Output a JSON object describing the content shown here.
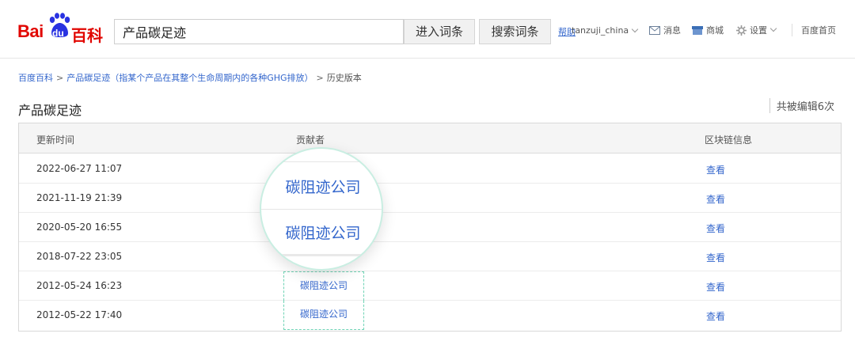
{
  "header": {
    "logo_text": "Bai",
    "logo_du": "du",
    "logo_baike": "百科",
    "search_value": "产品碳足迹",
    "enter_button": "进入词条",
    "search_button": "搜索词条",
    "help": "帮助",
    "username": "tanzuji_china",
    "messages": "消息",
    "mall": "商城",
    "settings": "设置",
    "home": "百度首页"
  },
  "breadcrumb": {
    "root": "百度百科",
    "entry": "产品碳足迹（指某个产品在其整个生命周期内的各种GHG排放）",
    "current": "历史版本",
    "separator": ">"
  },
  "page": {
    "title": "产品碳足迹",
    "edit_count": "共被编辑6次"
  },
  "table": {
    "columns": [
      "更新时间",
      "贡献者",
      "区块链信息"
    ],
    "rows": [
      {
        "time": "2022-06-27 11:07",
        "contributor": "",
        "chain": "查看"
      },
      {
        "time": "2021-11-19 21:39",
        "contributor": "",
        "chain": "查看"
      },
      {
        "time": "2020-05-20 16:55",
        "contributor": "",
        "chain": "查看"
      },
      {
        "time": "2018-07-22 23:05",
        "contributor": "",
        "chain": "查看"
      },
      {
        "time": "2012-05-24 16:23",
        "contributor": "碳阻迹公司",
        "chain": "查看"
      },
      {
        "time": "2012-05-22 17:40",
        "contributor": "碳阻迹公司",
        "chain": "查看"
      }
    ]
  },
  "magnifier": {
    "line1": "碳阻迹公司",
    "line2": "碳阻迹公司"
  },
  "colors": {
    "brand_red": "#e10601",
    "brand_blue": "#2932e1",
    "link_blue": "#3366cc",
    "highlight_green": "#6fd3b5"
  }
}
